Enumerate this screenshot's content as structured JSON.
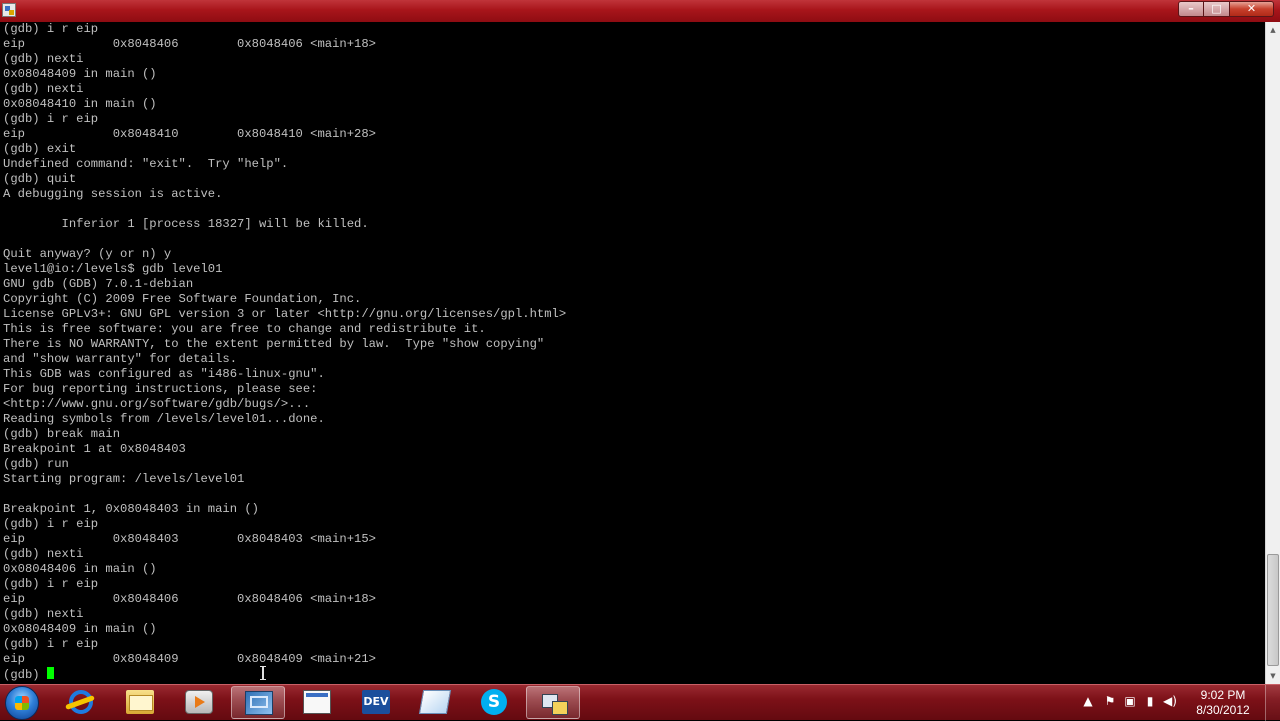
{
  "window": {
    "controls": {
      "minimize": "–",
      "maximize": "□",
      "close": "✕"
    }
  },
  "terminal": {
    "lines": [
      "(gdb) i r eip",
      "eip            0x8048406        0x8048406 <main+18>",
      "(gdb) nexti",
      "0x08048409 in main ()",
      "(gdb) nexti",
      "0x08048410 in main ()",
      "(gdb) i r eip",
      "eip            0x8048410        0x8048410 <main+28>",
      "(gdb) exit",
      "Undefined command: \"exit\".  Try \"help\".",
      "(gdb) quit",
      "A debugging session is active.",
      "",
      "        Inferior 1 [process 18327] will be killed.",
      "",
      "Quit anyway? (y or n) y",
      "level1@io:/levels$ gdb level01",
      "GNU gdb (GDB) 7.0.1-debian",
      "Copyright (C) 2009 Free Software Foundation, Inc.",
      "License GPLv3+: GNU GPL version 3 or later <http://gnu.org/licenses/gpl.html>",
      "This is free software: you are free to change and redistribute it.",
      "There is NO WARRANTY, to the extent permitted by law.  Type \"show copying\"",
      "and \"show warranty\" for details.",
      "This GDB was configured as \"i486-linux-gnu\".",
      "For bug reporting instructions, please see:",
      "<http://www.gnu.org/software/gdb/bugs/>...",
      "Reading symbols from /levels/level01...done.",
      "(gdb) break main",
      "Breakpoint 1 at 0x8048403",
      "(gdb) run",
      "Starting program: /levels/level01",
      "",
      "Breakpoint 1, 0x08048403 in main ()",
      "(gdb) i r eip",
      "eip            0x8048403        0x8048403 <main+15>",
      "(gdb) nexti",
      "0x08048406 in main ()",
      "(gdb) i r eip",
      "eip            0x8048406        0x8048406 <main+18>",
      "(gdb) nexti",
      "0x08048409 in main ()",
      "(gdb) i r eip",
      "eip            0x8048409        0x8048409 <main+21>"
    ],
    "prompt": "(gdb) ",
    "colors": {
      "text": "#c0c0c0",
      "background": "#000000",
      "cursor": "#00ff00"
    }
  },
  "scrollbar": {
    "up_arrow": "▲",
    "down_arrow": "▼",
    "position": 0.97
  },
  "taskbar": {
    "colors": {
      "bar": "#7d1118",
      "title_bar": "#a8151b"
    },
    "buttons": [
      {
        "name": "internet-explorer",
        "icon": "ie-icon",
        "active": false
      },
      {
        "name": "windows-explorer",
        "icon": "folder-icon",
        "active": false
      },
      {
        "name": "media-player",
        "icon": "media-icon",
        "active": false
      },
      {
        "name": "remote-desktop",
        "icon": "remote-icon",
        "active": true
      },
      {
        "name": "window-app",
        "icon": "window-icon",
        "active": false
      },
      {
        "name": "dev-app",
        "icon": "dev-icon",
        "label": "DEV",
        "active": false
      },
      {
        "name": "notes-app",
        "icon": "note-icon",
        "active": false
      },
      {
        "name": "skype",
        "icon": "skype-icon",
        "label": "S",
        "active": false
      },
      {
        "name": "putty",
        "icon": "network-icon",
        "active": true
      }
    ],
    "tray": {
      "overflow_arrow": "▲",
      "icons": [
        "flag-icon",
        "network-icon",
        "signal-icon",
        "volume-icon"
      ],
      "time": "9:02 PM",
      "date": "8/30/2012"
    }
  }
}
